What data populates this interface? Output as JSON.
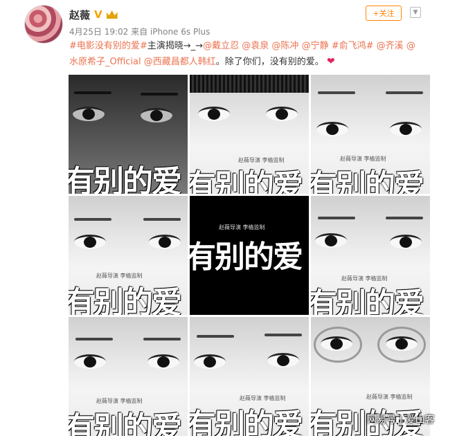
{
  "user": {
    "name": "赵薇",
    "verified_badge": "V",
    "avatar_icon": "avatar-flower-icon",
    "follow_label": "+关注",
    "menu_icon": "chevron-down-icon"
  },
  "meta": {
    "time_source": "4月25日 19:02 来自 iPhone 6s Plus"
  },
  "post": {
    "hashtag": "#电影没有别的爱#",
    "intro": "主演揭晓→_→",
    "mentions": [
      "@戴立忍",
      "@袁泉",
      "@陈冲",
      "@宁静",
      "#俞飞鸿#",
      "@齐溪",
      "@水原希子_Official",
      "@西藏昌都人韩红"
    ],
    "outro": "。除了你们，没有别的爱。",
    "heart": "❤"
  },
  "posters": {
    "credit": "赵薇导演 李樯监制",
    "title": "有别的爱",
    "title_black": "有别的爱"
  },
  "watermark": "网易号 | 爱山客"
}
